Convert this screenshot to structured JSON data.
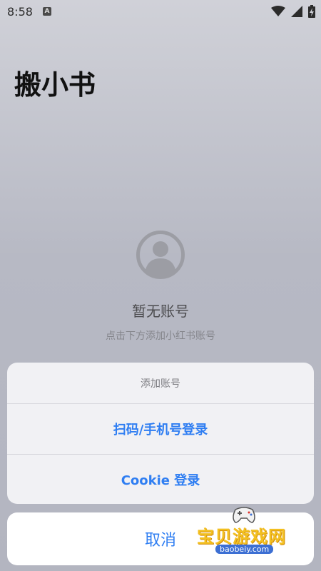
{
  "status_bar": {
    "time": "8:58",
    "notification_icon": "a-icon",
    "wifi_icon": "wifi-icon",
    "signal_icon": "signal-icon",
    "battery_icon": "battery-charging-icon"
  },
  "header": {
    "title": "搬小书"
  },
  "empty_state": {
    "icon": "user-avatar-icon",
    "title": "暂无账号",
    "subtitle": "点击下方添加小红书账号"
  },
  "action_sheet": {
    "title": "添加账号",
    "options": [
      {
        "label": "扫码/手机号登录"
      },
      {
        "label": "Cookie 登录"
      }
    ],
    "cancel_label": "取消",
    "accent_color": "#2f7ef2"
  },
  "watermark": {
    "text": "宝贝游戏网",
    "sub": "baobeiy.com"
  }
}
